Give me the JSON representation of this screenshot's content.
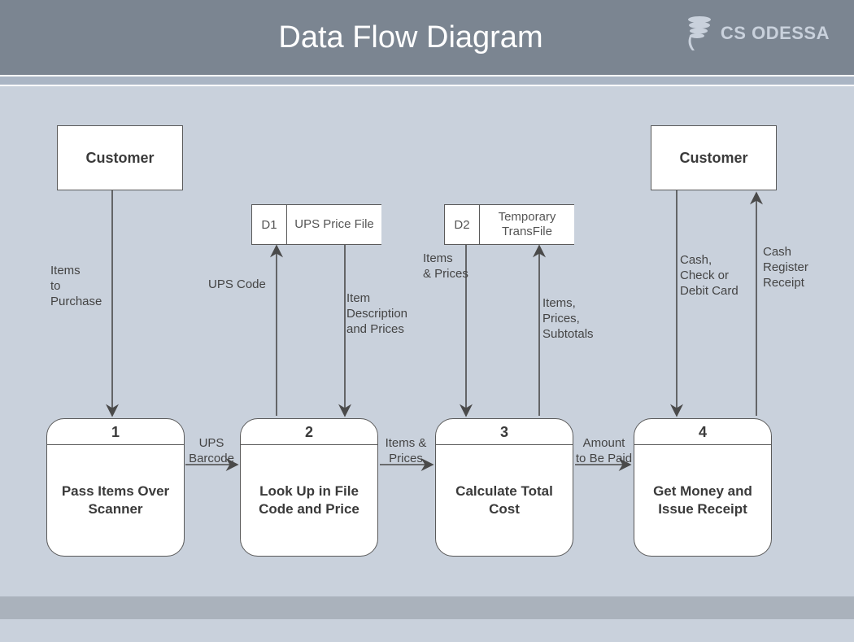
{
  "header": {
    "title": "Data Flow Diagram",
    "brand": "CS ODESSA"
  },
  "entities": {
    "customer_left": "Customer",
    "customer_right": "Customer"
  },
  "datastores": {
    "d1": {
      "id": "D1",
      "name": "UPS Price File"
    },
    "d2": {
      "id": "D2",
      "name": "Temporary TransFile"
    }
  },
  "processes": {
    "p1": {
      "num": "1",
      "name": "Pass Items Over Scanner"
    },
    "p2": {
      "num": "2",
      "name": "Look Up in File Code and Price"
    },
    "p3": {
      "num": "3",
      "name": "Calculate Total Cost"
    },
    "p4": {
      "num": "4",
      "name": "Get Money and Issue Receipt"
    }
  },
  "flows": {
    "items_to_purchase": "Items\nto Purchase",
    "ups_barcode": "UPS\nBarcode",
    "ups_code": "UPS Code",
    "item_desc_prices": "Item\nDescription\nand Prices",
    "items_prices_h": "Items &\nPrices",
    "items_prices_v": "Items\n& Prices",
    "items_prices_subtotals": "Items,\nPrices,\nSubtotals",
    "amount_to_be_paid": "Amount\nto Be Paid",
    "cash_check_debit": "Cash,\nCheck or\nDebit Card",
    "cash_register_receipt": "Cash\nRegister\nReceipt"
  }
}
